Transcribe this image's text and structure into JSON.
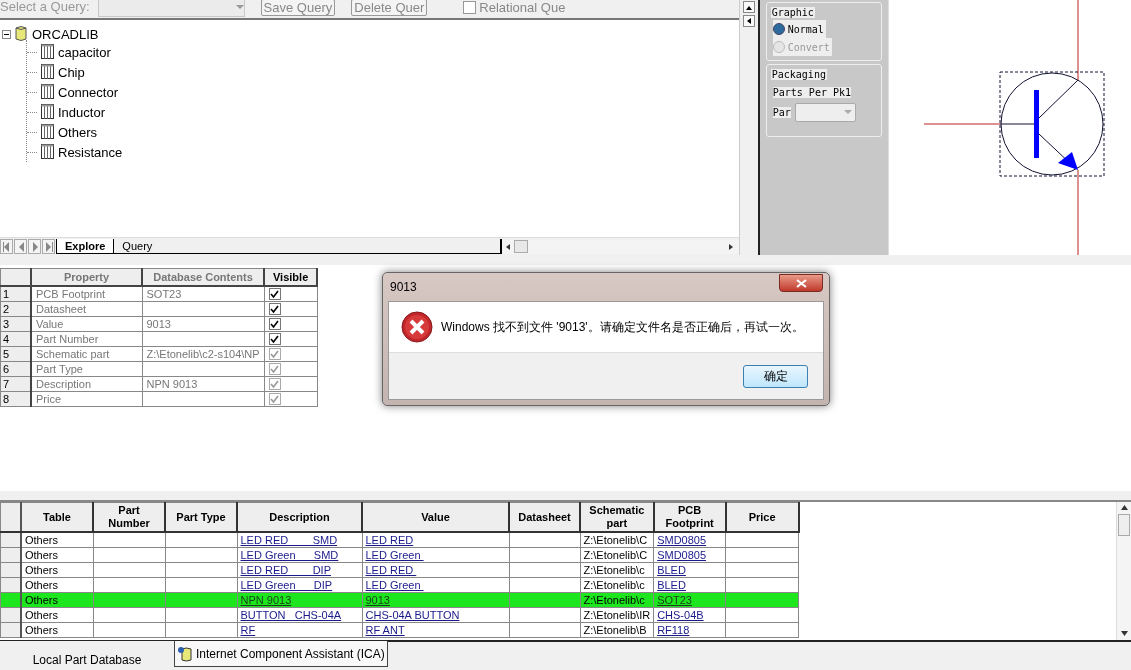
{
  "query_toolbar": {
    "label": "Select a Query:",
    "dropdown": {
      "disabled": true
    },
    "buttons": [
      {
        "label": "Save Query"
      },
      {
        "label": "Delete Quer"
      }
    ],
    "relational": {
      "label": "Relational Que",
      "checked": false
    }
  },
  "tree": [
    {
      "label": "ORCADLIB",
      "kind": "database",
      "expanded": true,
      "children": [
        {
          "label": "capacitor",
          "kind": "table"
        },
        {
          "label": "Chip",
          "kind": "table"
        },
        {
          "label": "Connector",
          "kind": "table"
        },
        {
          "label": "Inductor",
          "kind": "table"
        },
        {
          "label": "Others",
          "kind": "table"
        },
        {
          "label": "Resistance",
          "kind": "table"
        }
      ]
    }
  ],
  "tree_tabs": [
    {
      "label": "Explore",
      "selected": true
    },
    {
      "label": "Query",
      "selected": false
    }
  ],
  "graphic_group": {
    "title": "Graphic",
    "options": [
      {
        "label": "Normal",
        "selected": true,
        "disabled": false
      },
      {
        "label": "Convert",
        "selected": false,
        "disabled": true
      }
    ]
  },
  "packaging_group": {
    "title": "Packaging",
    "parts_per_pkg_label": "Parts Per Pk",
    "parts_per_pkg_value": "1",
    "part_label": "Par"
  },
  "property_grid": {
    "columns": [
      "Property",
      "Database Contents",
      "Visible"
    ],
    "rows": [
      {
        "index": "1",
        "property": "PCB Footprint",
        "contents": "SOT23",
        "checked": true,
        "disabled": false
      },
      {
        "index": "2",
        "property": "Datasheet",
        "contents": "",
        "checked": true,
        "disabled": false
      },
      {
        "index": "3",
        "property": "Value",
        "contents": "9013",
        "checked": true,
        "disabled": false
      },
      {
        "index": "4",
        "property": "Part Number",
        "contents": "",
        "checked": true,
        "disabled": false
      },
      {
        "index": "5",
        "property": "Schematic part",
        "contents": "Z:\\Etonelib\\c2-s104\\NP",
        "checked": true,
        "disabled": true
      },
      {
        "index": "6",
        "property": "Part Type",
        "contents": "",
        "checked": true,
        "disabled": true
      },
      {
        "index": "7",
        "property": "Description",
        "contents": "NPN 9013",
        "checked": true,
        "disabled": true
      },
      {
        "index": "8",
        "property": "Price",
        "contents": "",
        "checked": true,
        "disabled": true
      }
    ]
  },
  "dialog": {
    "title": "9013",
    "message": "Windows 找不到文件 '9013'。请确定文件名是否正确后，再试一次。",
    "button": "确定"
  },
  "parts_table": {
    "columns": [
      {
        "label": "Table"
      },
      {
        "label": "Part Number"
      },
      {
        "label": "Part Type"
      },
      {
        "label": "Description",
        "link": true
      },
      {
        "label": "Value",
        "link": true
      },
      {
        "label": "Datasheet"
      },
      {
        "label": "Schematic part"
      },
      {
        "label": "PCB Footprint",
        "link": true
      },
      {
        "label": "Price"
      }
    ],
    "rows": [
      {
        "selected": false,
        "cells": [
          "Others",
          "",
          "",
          "LED RED        SMD",
          "LED RED",
          "",
          "Z:\\Etonelib\\C",
          "SMD0805",
          ""
        ]
      },
      {
        "selected": false,
        "cells": [
          "Others",
          "",
          "",
          "LED Green      SMD",
          "LED Green ",
          "",
          "Z:\\Etonelib\\C",
          "SMD0805",
          ""
        ]
      },
      {
        "selected": false,
        "cells": [
          "Others",
          "",
          "",
          "LED RED        DIP",
          "LED RED ",
          "",
          "Z:\\Etonelib\\c",
          "BLED",
          ""
        ]
      },
      {
        "selected": false,
        "cells": [
          "Others",
          "",
          "",
          "LED Green      DIP",
          "LED Green ",
          "",
          "Z:\\Etonelib\\c",
          "BLED",
          ""
        ]
      },
      {
        "selected": true,
        "cells": [
          "Others",
          "",
          "",
          "NPN 9013",
          "9013",
          "",
          "Z:\\Etonelib\\c",
          "SOT23",
          ""
        ]
      },
      {
        "selected": false,
        "cells": [
          "Others",
          "",
          "",
          "BUTTON   CHS-04A",
          "CHS-04A BUTTON",
          "",
          "Z:\\Etonelib\\IR",
          "CHS-04B",
          ""
        ]
      },
      {
        "selected": false,
        "cells": [
          "Others",
          "",
          "",
          "RF",
          "RF ANT",
          "",
          "Z:\\Etonelib\\B",
          "RF118",
          ""
        ]
      }
    ]
  },
  "bottom_tabs": [
    {
      "label": "Local Part Database",
      "selected": true,
      "kind": "plain"
    },
    {
      "label": "Internet Component Assistant (ICA)",
      "selected": false,
      "kind": "icon"
    }
  ]
}
